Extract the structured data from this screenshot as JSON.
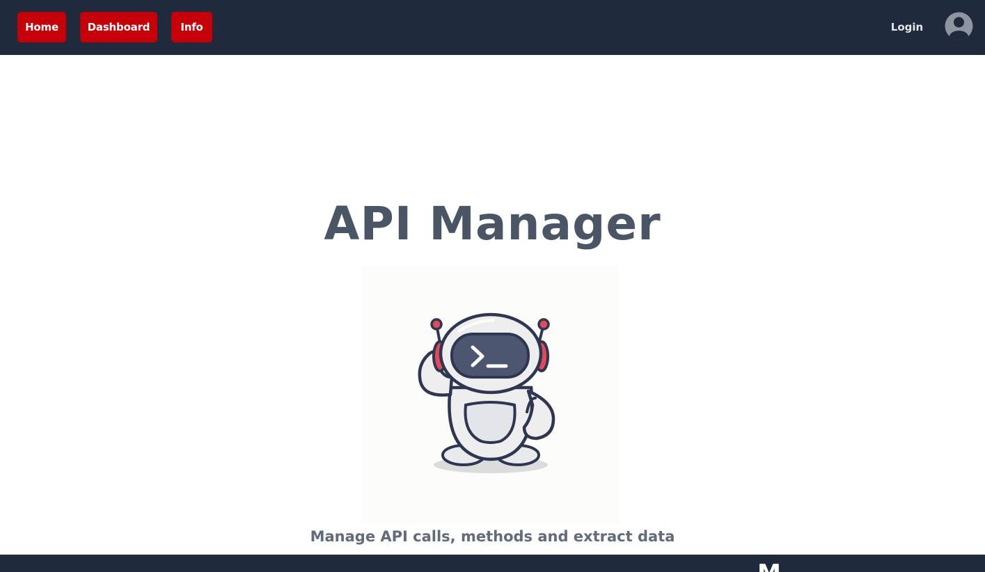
{
  "nav": {
    "home_label": "Home",
    "dashboard_label": "Dashboard",
    "info_label": "Info",
    "login_label": "Login",
    "avatar_icon": "user-avatar-icon"
  },
  "hero": {
    "title": "API Manager",
    "subtitle": "Manage API calls, methods and extract data",
    "illustration_icon": "robot-terminal-icon"
  },
  "footer": {
    "partial_text": "M"
  },
  "colors": {
    "navbar_bg": "#1f2a3c",
    "button_red": "#c50008",
    "title_color": "#4a5566",
    "subtitle_color": "#616b7a"
  }
}
